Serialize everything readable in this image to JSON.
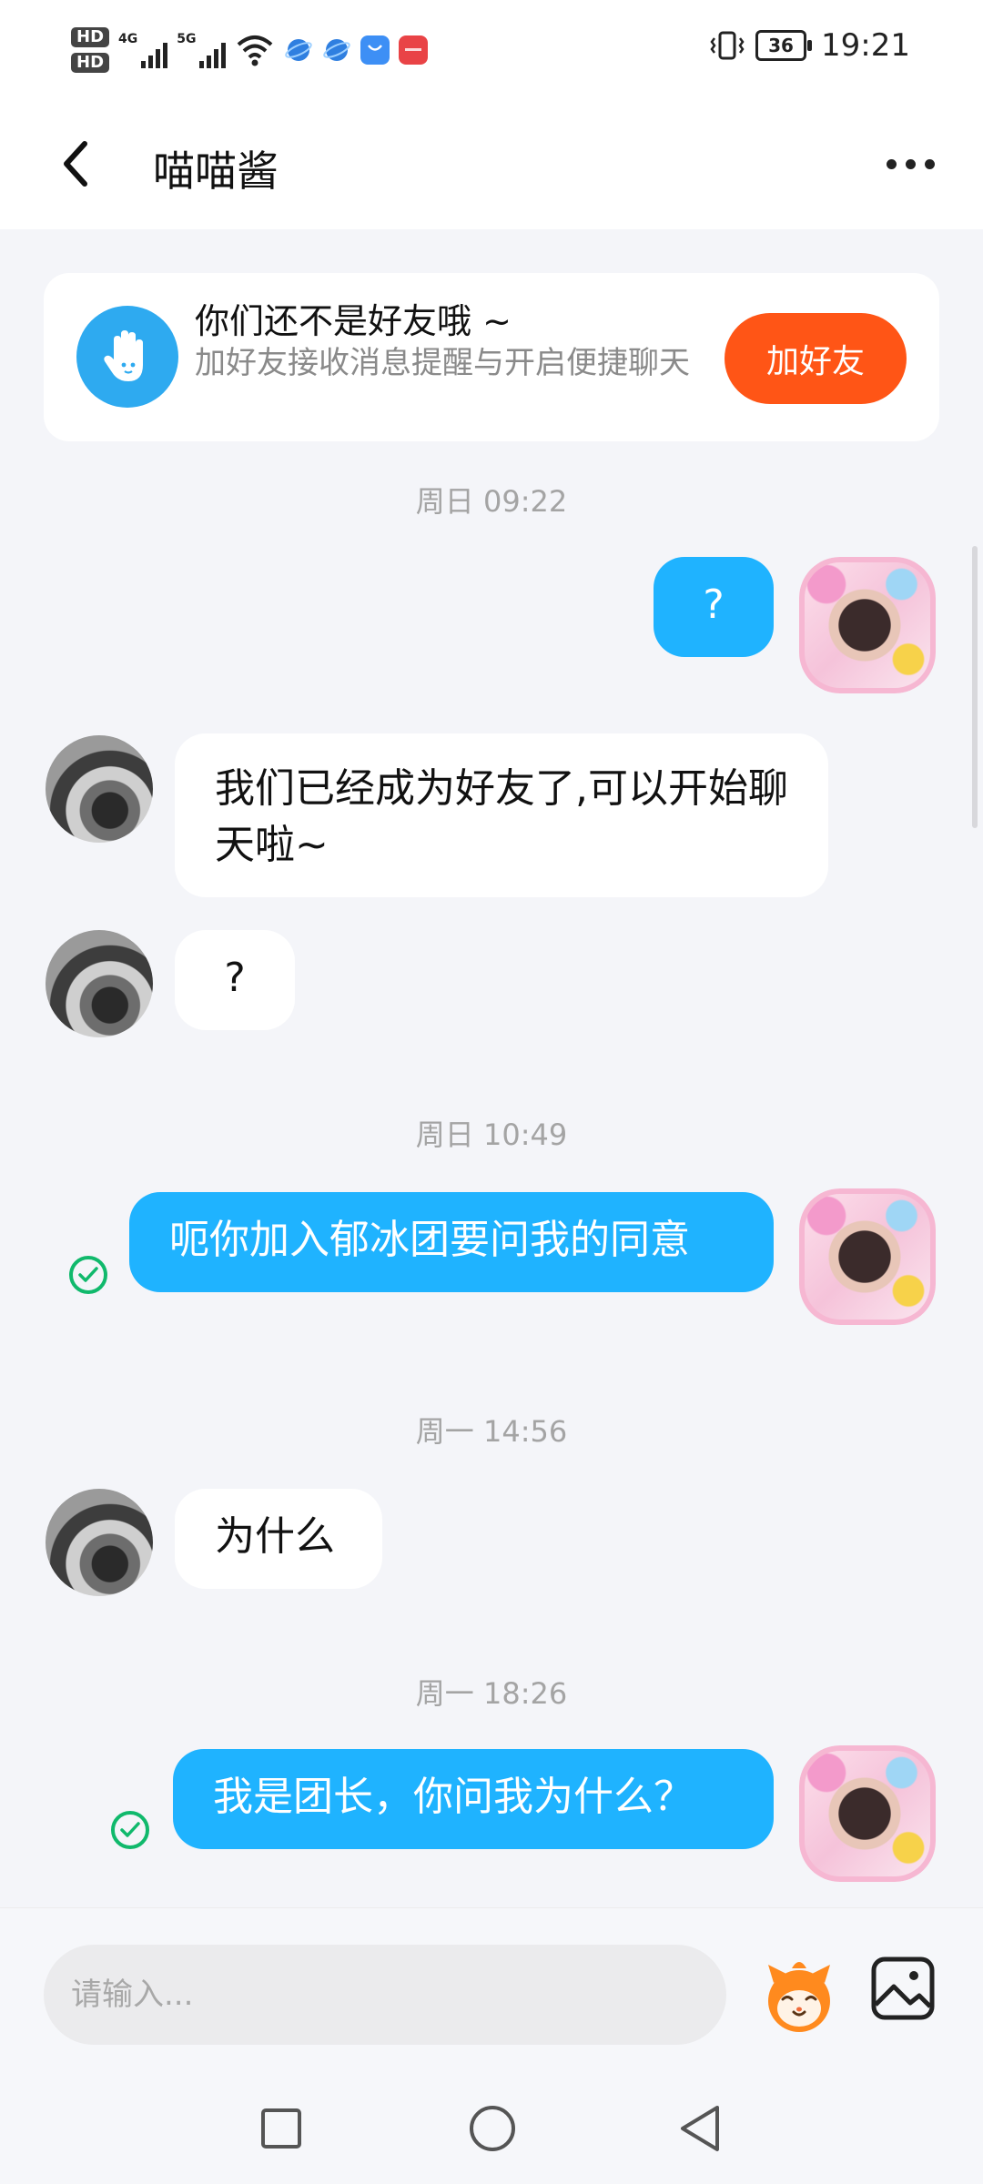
{
  "status_bar": {
    "hd1": "HD",
    "hd2": "HD",
    "net1": "4G",
    "net2": "5G",
    "battery": "36",
    "time": "19:21",
    "app_icons": [
      "browser-icon",
      "browser-icon",
      "store-icon",
      "huawei-icon"
    ],
    "colors": {
      "store": "#3d8ff5",
      "huawei": "#e94346",
      "browser": "#2f7fe0"
    }
  },
  "header": {
    "title": "喵喵酱"
  },
  "banner": {
    "title": "你们还不是好友哦 ~",
    "subtitle": "加好友接收消息提醒与开启便捷聊天",
    "button": "加好友",
    "accent": "#ff5516"
  },
  "messages": {
    "ts1": "周日 09:22",
    "m1": "?",
    "m2": "我们已经成为好友了,可以开始聊天啦~",
    "m3": "?",
    "ts2": "周日 10:49",
    "m4": "呃你加入郁冰团要问我的同意",
    "ts3": "周一 14:56",
    "m5": "为什么",
    "ts4": "周一 18:26",
    "m6": "我是团长，你问我为什么？"
  },
  "input": {
    "placeholder": "请输入..."
  },
  "colors": {
    "outgoing_bubble": "#1fb3ff",
    "incoming_bubble": "#ffffff",
    "background": "#f4f5f9",
    "read_check": "#10b96c"
  }
}
